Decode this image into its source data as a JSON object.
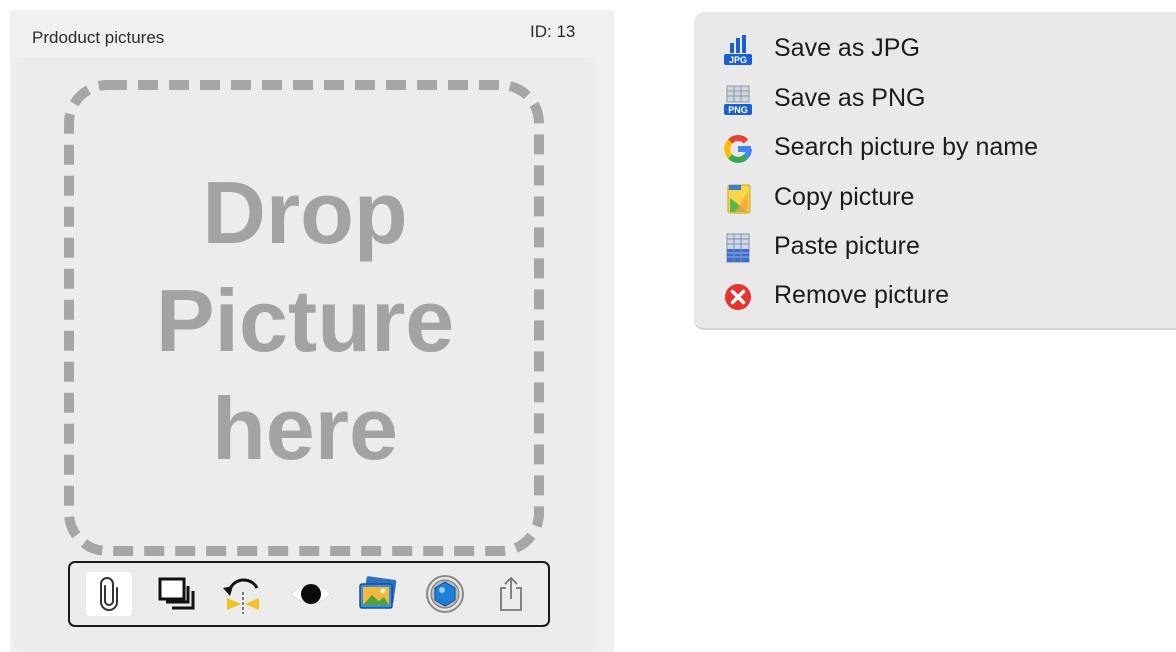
{
  "panel": {
    "title": "Prdoduct pictures",
    "id_text": "ID: 13",
    "drop_text": [
      "Drop",
      "Picture",
      "here"
    ]
  },
  "toolbar": {
    "tools": [
      {
        "name": "attach",
        "icon": "paperclip-icon",
        "active": true
      },
      {
        "name": "duplicate",
        "icon": "stacked-frames-icon",
        "active": false
      },
      {
        "name": "flip",
        "icon": "flip-rotate-icon",
        "active": false
      },
      {
        "name": "preview",
        "icon": "eye-icon",
        "active": false
      },
      {
        "name": "photos",
        "icon": "photos-icon",
        "active": false
      },
      {
        "name": "camera",
        "icon": "aperture-icon",
        "active": false
      },
      {
        "name": "share",
        "icon": "share-icon",
        "active": false
      }
    ]
  },
  "menu": {
    "items": [
      {
        "label": "Save as JPG",
        "icon": "jpg-file-icon"
      },
      {
        "label": "Save as PNG",
        "icon": "png-file-icon"
      },
      {
        "label": "Search picture by name",
        "icon": "google-icon"
      },
      {
        "label": "Copy picture",
        "icon": "copy-picture-icon"
      },
      {
        "label": "Paste picture",
        "icon": "paste-picture-icon"
      },
      {
        "label": "Remove picture",
        "icon": "remove-icon"
      }
    ]
  },
  "colors": {
    "panel_bg": "#f0f0f0",
    "drop_text": "#a3a3a3",
    "dash": "#a6a6a6",
    "menu_bg": "#e9e9e9",
    "remove_red": "#e8322e",
    "google_blue": "#4285f4"
  }
}
